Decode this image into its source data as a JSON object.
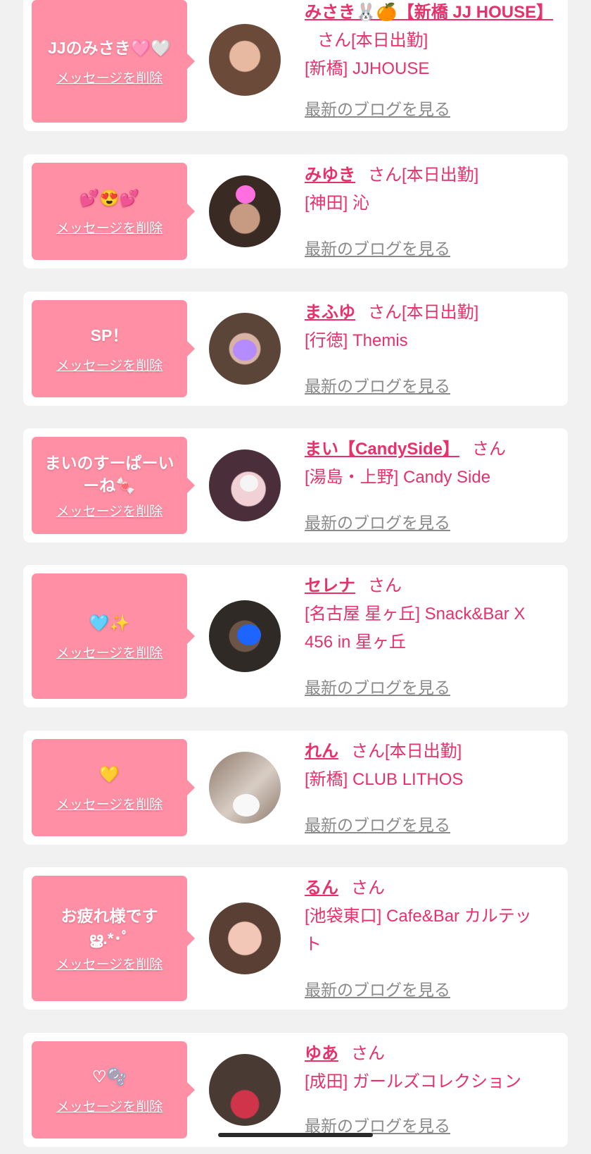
{
  "cards": [
    {
      "message": "JJのみさき🩷🤍",
      "delete_label": "メッセージを削除",
      "name": "みさき🐰🍊【新橋 JJ HOUSE】",
      "suffix": "さん[本日出勤]",
      "shop": "[新橋] JJHOUSE",
      "blog_label": "最新のブログを見る",
      "avatar_colors": [
        "#6b4a3a",
        "#e7b9a0"
      ]
    },
    {
      "message": "💕😍💕",
      "delete_label": "メッセージを削除",
      "name": "みゆき",
      "suffix": "さん[本日出勤]",
      "shop": "[神田] 沁",
      "blog_label": "最新のブログを見る",
      "avatar_colors": [
        "#3a2a24",
        "#c79a82"
      ]
    },
    {
      "message": "SP！",
      "delete_label": "メッセージを削除",
      "name": "まふゆ",
      "suffix": "さん[本日出勤]",
      "shop": "[行徳] Themis",
      "blog_label": "最新のブログを見る",
      "avatar_colors": [
        "#5a4538",
        "#d8b2a4"
      ]
    },
    {
      "message": "まいのすーぱーいーね🍬",
      "delete_label": "メッセージを削除",
      "name": "まい【CandySide】",
      "suffix": "さん",
      "shop": "[湯島・上野] Candy Side",
      "blog_label": "最新のブログを見る",
      "avatar_colors": [
        "#4a2f3a",
        "#f1d0d6"
      ]
    },
    {
      "message": "🩵✨",
      "delete_label": "メッセージを削除",
      "name": "セレナ",
      "suffix": "さん",
      "shop": "[名古屋 星ヶ丘] Snack&Bar X 456 in 星ヶ丘",
      "blog_label": "最新のブログを見る",
      "avatar_colors": [
        "#2f2a26",
        "#6b5546"
      ]
    },
    {
      "message": "💛",
      "delete_label": "メッセージを削除",
      "name": "れん",
      "suffix": "さん[本日出勤]",
      "shop": "[新橋] CLUB LITHOS",
      "blog_label": "最新のブログを見る",
      "avatar_colors": [
        "#8e7a6c",
        "#d8cdc4"
      ]
    },
    {
      "message": "お疲れ様です ൠ.*･ﾟ",
      "delete_label": "メッセージを削除",
      "name": "るん",
      "suffix": "さん",
      "shop": "[池袋東口] Cafe&Bar カルテット",
      "blog_label": "最新のブログを見る",
      "avatar_colors": [
        "#5a4034",
        "#f3c7b8"
      ]
    },
    {
      "message": "♡🫧",
      "delete_label": "メッセージを削除",
      "name": "ゆあ",
      "suffix": "さん",
      "shop": "[成田] ガールズコレクション",
      "blog_label": "最新のブログを見る",
      "avatar_colors": [
        "#4a3a34",
        "#d0344a"
      ]
    }
  ],
  "colors": {
    "accent": "#e8306a",
    "bubble": "#ff8fa5",
    "background": "#f1f1f1",
    "link_gray": "#8a8a8a"
  }
}
